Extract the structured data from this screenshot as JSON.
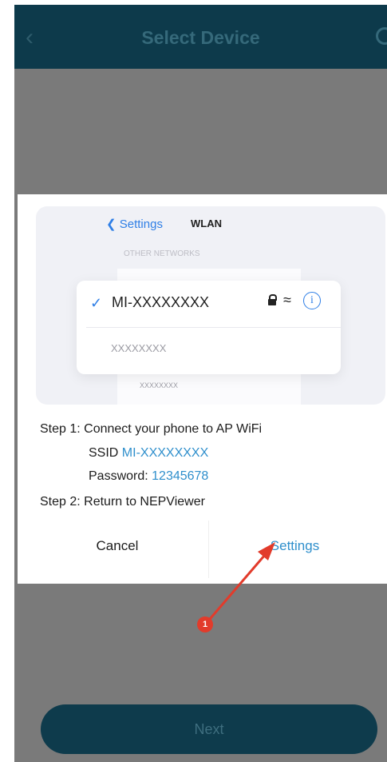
{
  "header": {
    "title": "Select Device",
    "back_icon": "chevron-left-icon",
    "refresh_icon": "refresh-icon"
  },
  "footer": {
    "next_label": "Next"
  },
  "dialog": {
    "illustration": {
      "back_label": "Settings",
      "title": "WLAN",
      "section": "OTHER NETWORKS",
      "connected_ssid": "MI-XXXXXXXX",
      "network_2": "XXXXXXXX",
      "network_3": "XXXXXXXX"
    },
    "step1": "Step 1: Connect your phone to AP WiFi",
    "ssid_label": "SSID ",
    "ssid_value": "MI-XXXXXXXX",
    "password_label": "Password: ",
    "password_value": "12345678",
    "step2": "Step 2: Return to NEPViewer",
    "cancel_label": "Cancel",
    "settings_label": "Settings"
  },
  "annotation": {
    "number": "1"
  },
  "colors": {
    "header_bg": "#0d3a4b",
    "accent": "#2f8fcc",
    "overlay": "#7a7a7a",
    "annotation": "#e23b2b"
  }
}
